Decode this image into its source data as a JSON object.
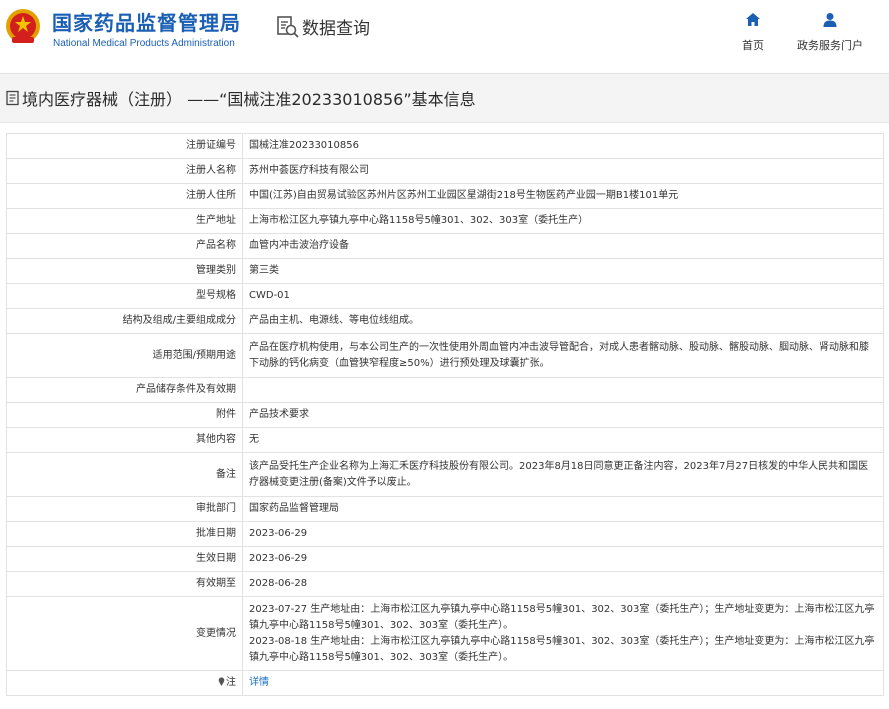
{
  "header": {
    "site_name_cn": "国家药品监督管理局",
    "site_name_en": "National Medical Products Administration",
    "data_query_label": "数据查询",
    "nav": {
      "home": "首页",
      "portal": "政务服务门户"
    }
  },
  "page_title": "境内医疗器械（注册） ——“国械注准20233010856”基本信息",
  "detail": {
    "rows": [
      {
        "label": "注册证编号",
        "value": "国械注准20233010856"
      },
      {
        "label": "注册人名称",
        "value": "苏州中荟医疗科技有限公司"
      },
      {
        "label": "注册人住所",
        "value": "中国(江苏)自由贸易试验区苏州片区苏州工业园区星湖街218号生物医药产业园一期B1楼101单元"
      },
      {
        "label": "生产地址",
        "value": "上海市松江区九亭镇九亭中心路1158号5幢301、302、303室（委托生产）"
      },
      {
        "label": "产品名称",
        "value": "血管内冲击波治疗设备"
      },
      {
        "label": "管理类别",
        "value": "第三类"
      },
      {
        "label": "型号规格",
        "value": "CWD-01"
      },
      {
        "label": "结构及组成/主要组成成分",
        "value": "产品由主机、电源线、等电位线组成。"
      },
      {
        "label": "适用范围/预期用途",
        "value": "产品在医疗机构使用，与本公司生产的一次性使用外周血管内冲击波导管配合，对成人患者髂动脉、股动脉、髂股动脉、腘动脉、肾动脉和膝下动脉的钙化病变（血管狭窄程度≥50%）进行预处理及球囊扩张。"
      },
      {
        "label": "产品储存条件及有效期",
        "value": ""
      },
      {
        "label": "附件",
        "value": "产品技术要求"
      },
      {
        "label": "其他内容",
        "value": "无"
      },
      {
        "label": "备注",
        "value": "该产品受托生产企业名称为上海汇禾医疗科技股份有限公司。2023年8月18日同意更正备注内容，2023年7月27日核发的中华人民共和国医疗器械变更注册(备案)文件予以废止。"
      },
      {
        "label": "审批部门",
        "value": "国家药品监督管理局"
      },
      {
        "label": "批准日期",
        "value": "2023-06-29"
      },
      {
        "label": "生效日期",
        "value": "2023-06-29"
      },
      {
        "label": "有效期至",
        "value": "2028-06-28"
      }
    ],
    "change_label": "变更情况",
    "changes": [
      "2023-07-27 生产地址由：上海市松江区九亭镇九亭中心路1158号5幢301、302、303室（委托生产）；生产地址变更为：上海市松江区九亭镇九亭中心路1158号5幢301、302、303室（委托生产）。",
      "2023-08-18 生产地址由：上海市松江区九亭镇九亭中心路1158号5幢301、302、303室（委托生产）；生产地址变更为：上海市松江区九亭镇九亭中心路1158号5幢301、302、303室（委托生产）。"
    ],
    "note_label": "注",
    "note_link": "详情"
  }
}
